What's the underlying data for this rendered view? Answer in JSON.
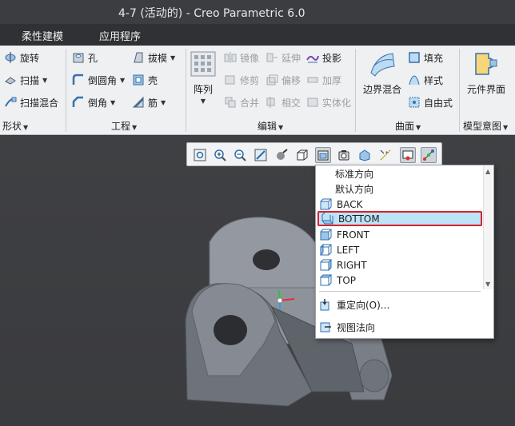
{
  "window": {
    "title": "4-7 (活动的) - Creo Parametric 6.0"
  },
  "tabs": [
    "柔性建模",
    "应用程序"
  ],
  "ribbon": {
    "shape": {
      "items": [
        "旋转",
        "扫描",
        "扫描混合"
      ],
      "group_label": "形状"
    },
    "engineering": {
      "items": [
        "孔",
        "倒圆角",
        "倒角",
        "拔模",
        "壳",
        "筋"
      ],
      "group_label": "工程"
    },
    "editing": {
      "big_button": "阵列",
      "items": [
        "镜像",
        "延伸",
        "投影",
        "修剪",
        "偏移",
        "加厚",
        "合并",
        "相交",
        "实体化"
      ],
      "group_label": "编辑"
    },
    "surfaces": {
      "big_button": "边界混合",
      "items": [
        "填充",
        "样式",
        "自由式"
      ],
      "group_label": "曲面"
    },
    "model_intent": {
      "big_button": "元件界面",
      "group_label": "模型意图"
    }
  },
  "view_toolbar": {
    "buttons": [
      "refit-icon",
      "zoom-in-icon",
      "zoom-out-icon",
      "repaint-icon",
      "display-style-icon",
      "spin-center-icon",
      "saved-orientations-icon",
      "view-manager-icon",
      "annotation-display-icon",
      "datum-display-icon",
      "spin-settings-icon",
      "appearance-icon"
    ]
  },
  "orientation_menu": {
    "items": [
      "标准方向",
      "默认方向",
      "BACK",
      "BOTTOM",
      "FRONT",
      "LEFT",
      "RIGHT",
      "TOP"
    ],
    "selected": "BOTTOM",
    "actions": [
      "重定向(O)...",
      "视图法向"
    ]
  },
  "colors": {
    "title_bg": "#3b3d41",
    "ribbon_bg": "#eef0f2",
    "viewport_bg": "#3a3b3e",
    "highlight": "#bde3f7",
    "selection_border": "#d7232b",
    "model": "#8e949d"
  }
}
